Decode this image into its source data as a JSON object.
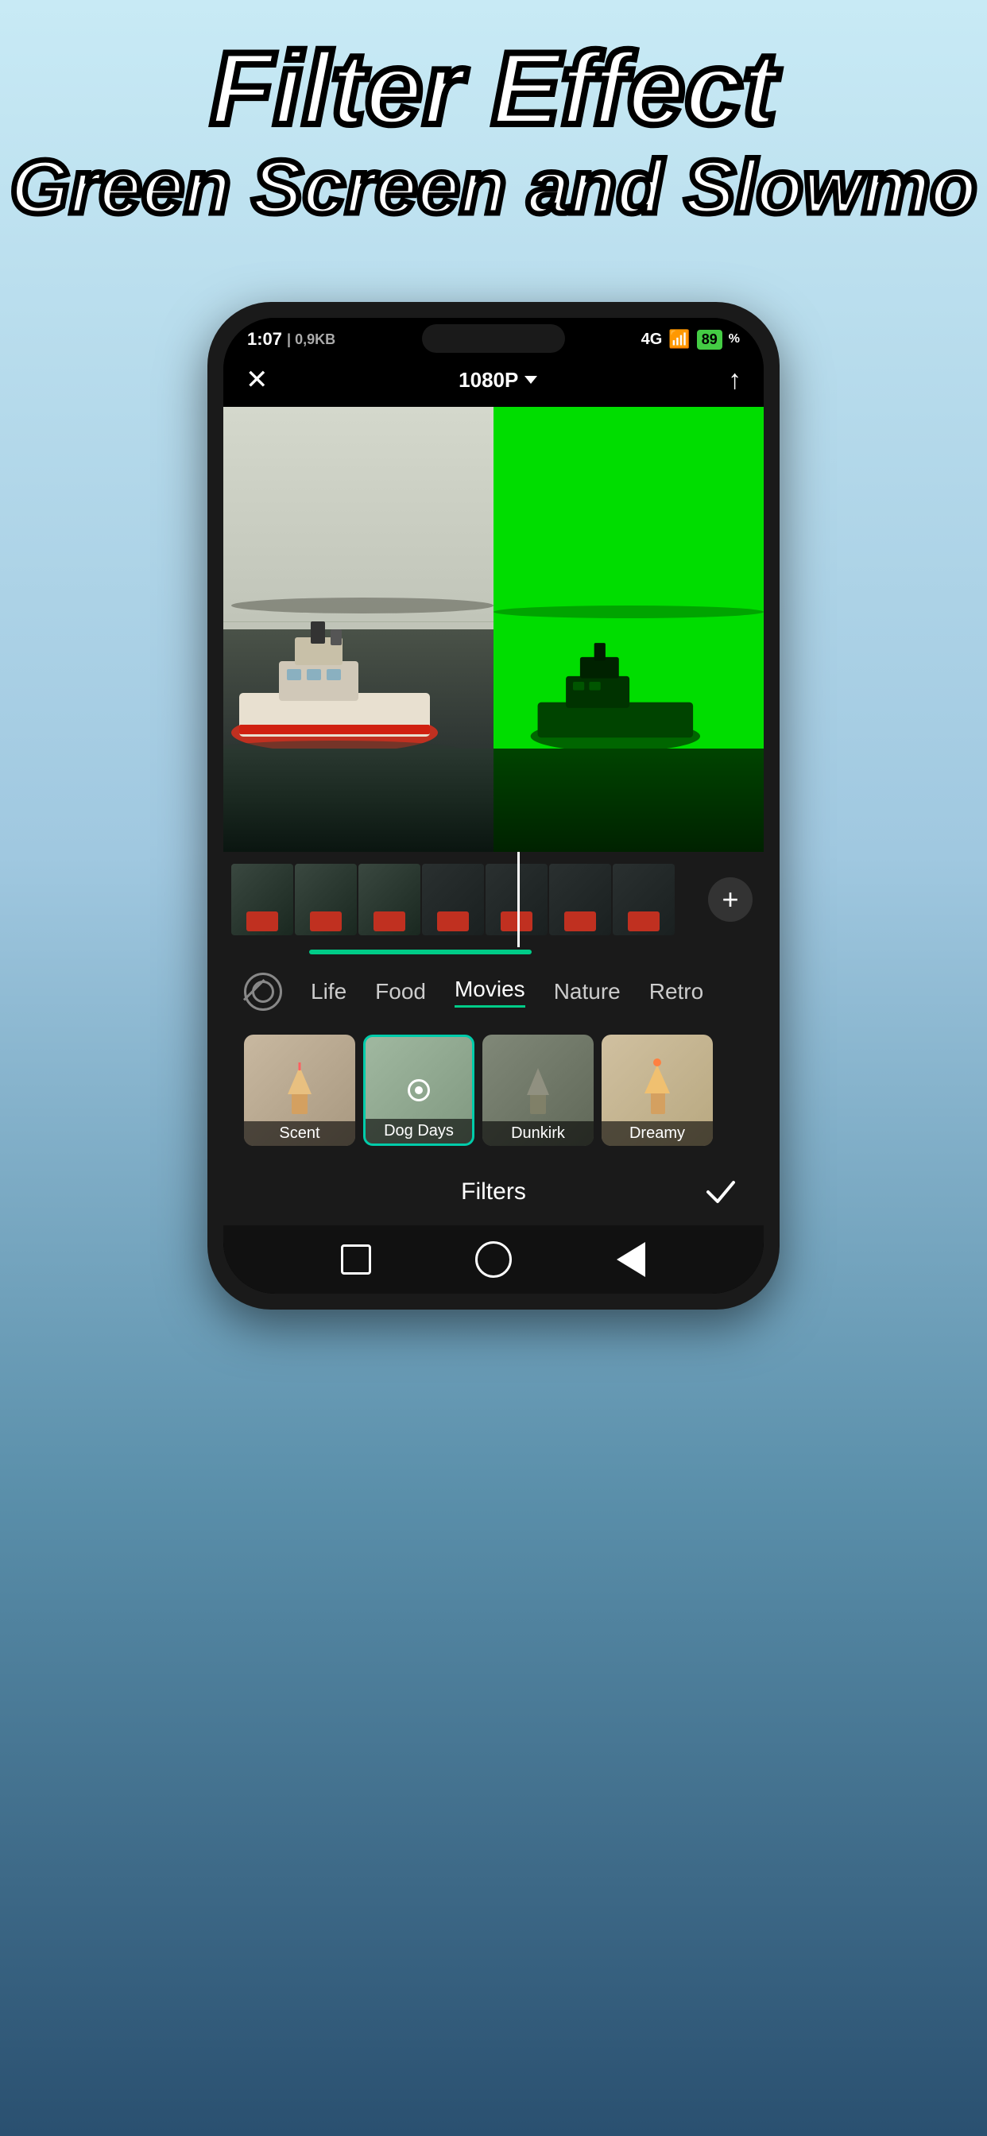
{
  "title": {
    "line1": "Filter Effect",
    "line2": "Green Screen and Slowmo"
  },
  "status_bar": {
    "time": "1:07",
    "data": "0,9KB",
    "signal": "4G",
    "battery": "89"
  },
  "app_header": {
    "close_label": "✕",
    "quality_label": "1080P",
    "share_label": "↑"
  },
  "timeline": {
    "add_button": "+"
  },
  "filter_categories": {
    "items": [
      {
        "id": "none",
        "label": ""
      },
      {
        "id": "life",
        "label": "Life"
      },
      {
        "id": "food",
        "label": "Food"
      },
      {
        "id": "movies",
        "label": "Movies"
      },
      {
        "id": "nature",
        "label": "Nature"
      },
      {
        "id": "retro",
        "label": "Retro"
      }
    ]
  },
  "filter_thumbs": [
    {
      "label": "Scent",
      "active": false
    },
    {
      "label": "Dog Days",
      "active": true
    },
    {
      "label": "Dunkirk",
      "active": false
    },
    {
      "label": "Dreamy",
      "active": false
    }
  ],
  "filter_bottom": {
    "label": "Filters",
    "checkmark": "✓"
  },
  "colors": {
    "accent_green": "#00cc88",
    "green_screen": "#00dd00",
    "active_border": "#00ccaa"
  }
}
